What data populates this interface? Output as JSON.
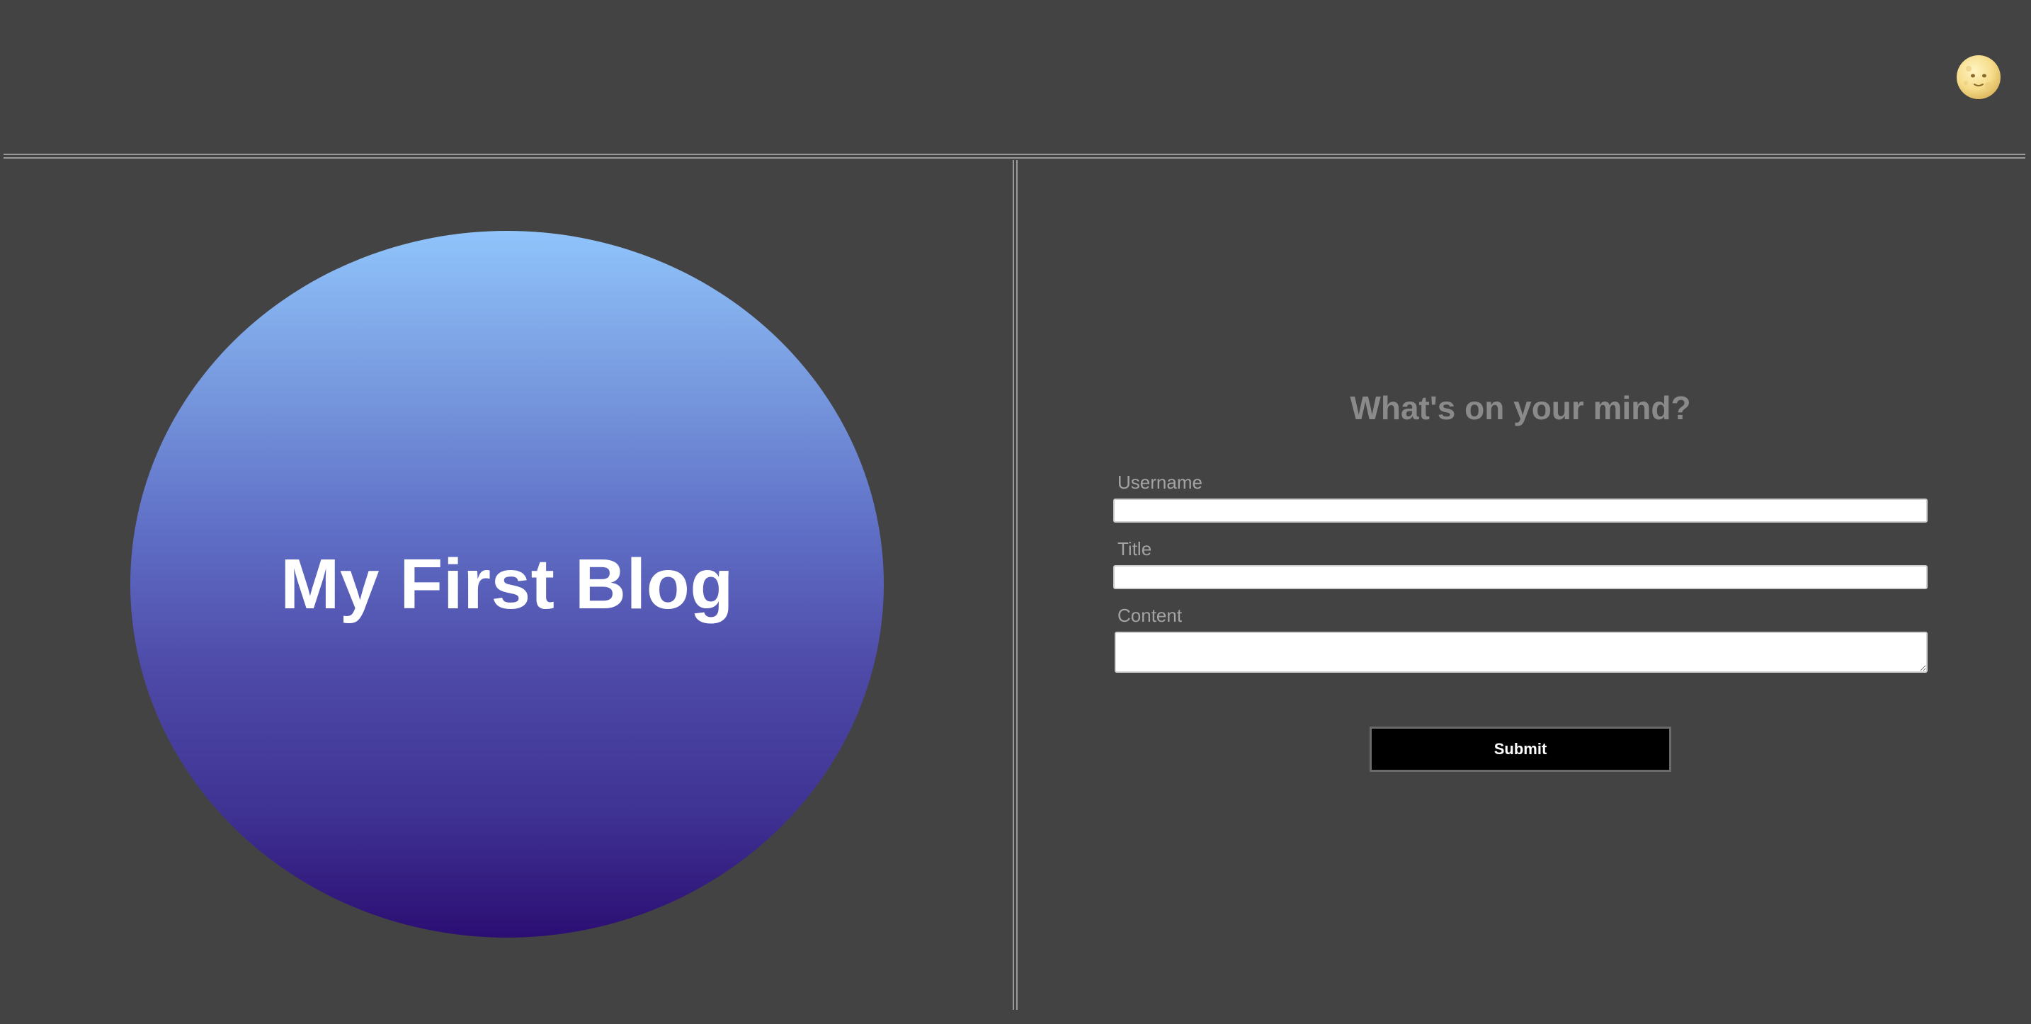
{
  "header": {
    "theme_toggle_icon": "full-moon-face-icon"
  },
  "hero": {
    "title": "My First Blog"
  },
  "form": {
    "heading": "What's on your mind?",
    "username_label": "Username",
    "username_value": "",
    "title_label": "Title",
    "title_value": "",
    "content_label": "Content",
    "content_value": "",
    "submit_label": "Submit"
  },
  "colors": {
    "background": "#434343",
    "divider": "#9a9a9a",
    "hero_gradient_top": "#90c4fb",
    "hero_gradient_bottom": "#2c0e73",
    "heading_text": "#8a8a8a",
    "label_text": "#a3a3a3",
    "submit_background": "#000000"
  }
}
